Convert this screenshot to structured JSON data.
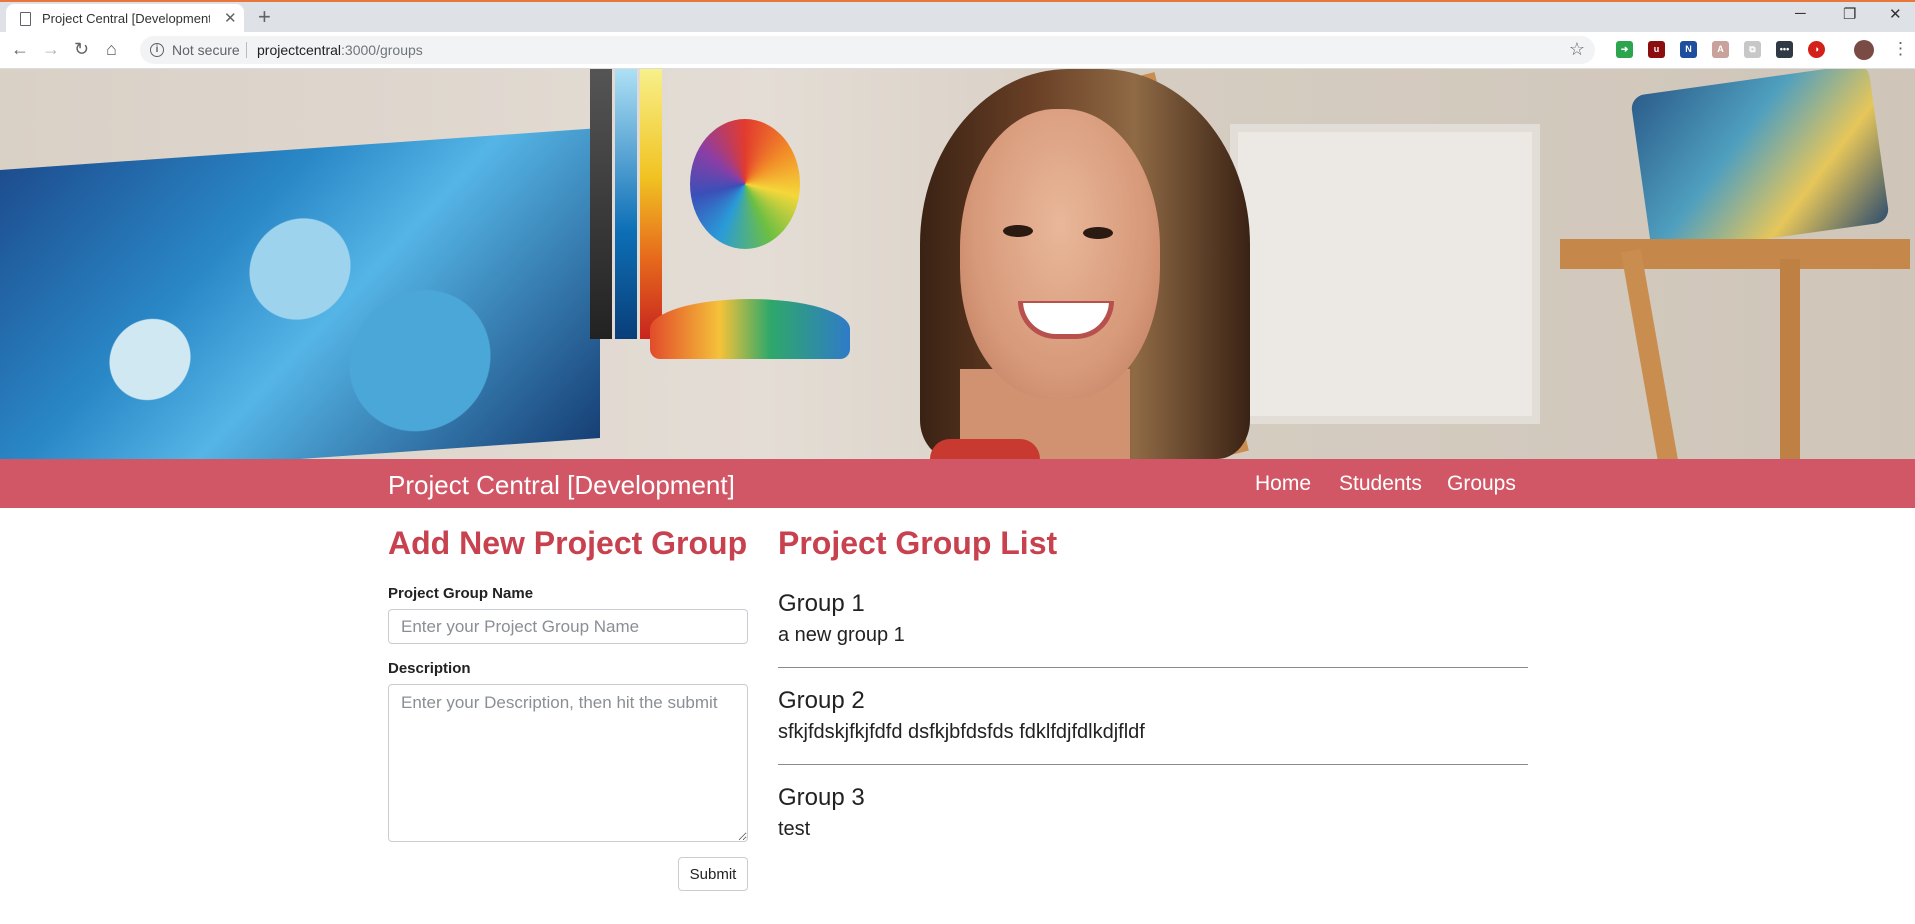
{
  "browser": {
    "tab_title": "Project Central [Development] | P",
    "new_tab_symbol": "+",
    "security_label": "Not secure",
    "url_host": "projectcentral",
    "url_path": ":3000/groups"
  },
  "site": {
    "brand": "Project Central [Development]",
    "nav": [
      {
        "label": "Home"
      },
      {
        "label": "Students"
      },
      {
        "label": "Groups"
      }
    ]
  },
  "form": {
    "title": "Add New Project Group",
    "name_label": "Project Group Name",
    "name_placeholder": "Enter your Project Group Name",
    "description_label": "Description",
    "description_placeholder": "Enter your Description, then hit the submit",
    "submit_label": "Submit"
  },
  "list": {
    "title": "Project Group List",
    "groups": [
      {
        "name": "Group 1",
        "description": "a new group 1"
      },
      {
        "name": "Group 2",
        "description": "sfkjfdskjfkjfdfd dsfkjbfdsfds fdklfdjfdlkdjfldf"
      },
      {
        "name": "Group 3",
        "description": "test"
      }
    ]
  },
  "colors": {
    "navbar": "#d25766",
    "heading": "#c8414f",
    "chrome_accent": "#e8773e"
  }
}
